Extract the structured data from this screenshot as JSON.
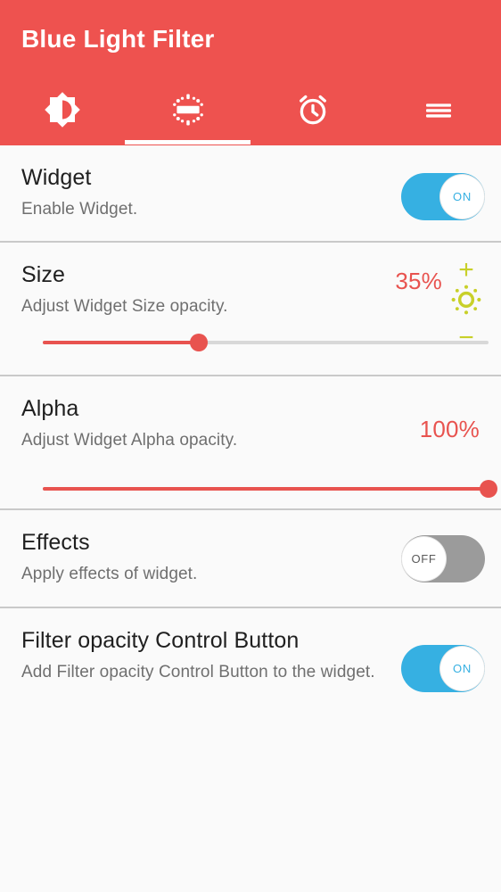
{
  "theme": {
    "primary": "#ee524f",
    "accent_red": "#e8534f",
    "toggle_on": "#36b0e2",
    "toggle_off": "#9b9b9b",
    "brightness_yellow": "#c8d029",
    "background": "#fafafa",
    "title_text": "#1f1f1f",
    "subtitle_text": "#6f6f6f"
  },
  "header": {
    "title": "Blue Light Filter",
    "tabs": [
      {
        "name": "brightness-tab",
        "icon": "brightness-contrast-icon",
        "label": "",
        "selected": false
      },
      {
        "name": "widget-tab",
        "icon": "settings-brightness-widget-icon",
        "label": "",
        "selected": true
      },
      {
        "name": "timer-tab",
        "icon": "alarm-clock-icon",
        "label": "",
        "selected": false
      },
      {
        "name": "menu-tab",
        "icon": "hamburger-menu-icon",
        "label": "",
        "selected": false
      }
    ]
  },
  "rows": [
    {
      "name": "widget",
      "title": "Widget",
      "subtitle": "Enable Widget.",
      "control": "toggle",
      "toggle_state": "ON"
    },
    {
      "name": "size",
      "title": "Size",
      "subtitle": "Adjust Widget Size opacity.",
      "control": "slider",
      "value_label": "35%",
      "value_percent": 35,
      "brightness_plus": "+",
      "brightness_minus": "−"
    },
    {
      "name": "alpha",
      "title": "Alpha",
      "subtitle": "Adjust Widget Alpha opacity.",
      "control": "slider",
      "value_label": "100%",
      "value_percent": 100
    },
    {
      "name": "effects",
      "title": "Effects",
      "subtitle": "Apply effects of widget.",
      "control": "toggle",
      "toggle_state": "OFF"
    },
    {
      "name": "filter-opacity-control-button",
      "title": "Filter opacity Control Button",
      "subtitle": "Add Filter opacity Control Button to the widget.",
      "control": "toggle",
      "toggle_state": "ON"
    }
  ]
}
